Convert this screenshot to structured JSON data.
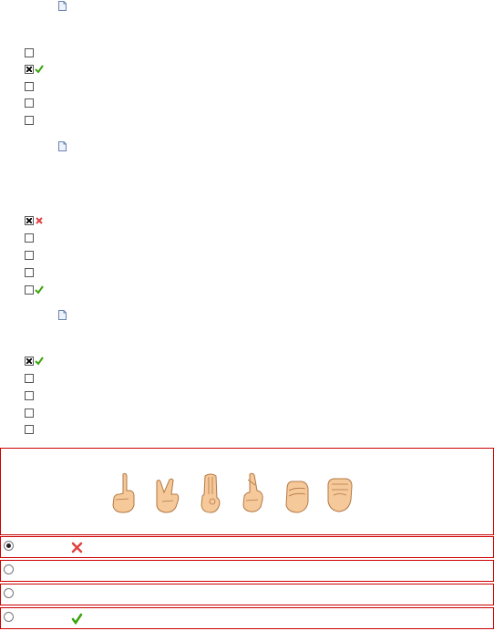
{
  "questions": [
    {
      "icon": "document-icon",
      "options": [
        {
          "checked": false,
          "mark": "none"
        },
        {
          "checked": true,
          "mark": "correct"
        },
        {
          "checked": false,
          "mark": "none"
        },
        {
          "checked": false,
          "mark": "none"
        },
        {
          "checked": false,
          "mark": "none"
        }
      ]
    },
    {
      "icon": "document-icon",
      "options": [
        {
          "checked": true,
          "mark": "incorrect"
        },
        {
          "checked": false,
          "mark": "none"
        },
        {
          "checked": false,
          "mark": "none"
        },
        {
          "checked": false,
          "mark": "none"
        },
        {
          "checked": false,
          "mark": "correct"
        }
      ]
    },
    {
      "icon": "document-icon",
      "options": [
        {
          "checked": true,
          "mark": "correct"
        },
        {
          "checked": false,
          "mark": "none"
        },
        {
          "checked": false,
          "mark": "none"
        },
        {
          "checked": false,
          "mark": "none"
        },
        {
          "checked": false,
          "mark": "none"
        }
      ]
    }
  ],
  "image_question": {
    "image": "hand-signs-image",
    "hand_signs": [
      "index-finger-sign",
      "two-finger-sign",
      "flat-hand-sign",
      "crossed-fingers-sign",
      "curved-hand-sign",
      "fist-sign"
    ]
  },
  "answer_options": [
    {
      "selected": true,
      "mark": "incorrect"
    },
    {
      "selected": false,
      "mark": "none"
    },
    {
      "selected": false,
      "mark": "none"
    },
    {
      "selected": false,
      "mark": "correct"
    }
  ],
  "colors": {
    "correct": "#3aa30a",
    "incorrect": "#e04040",
    "border": "#cc0000"
  }
}
